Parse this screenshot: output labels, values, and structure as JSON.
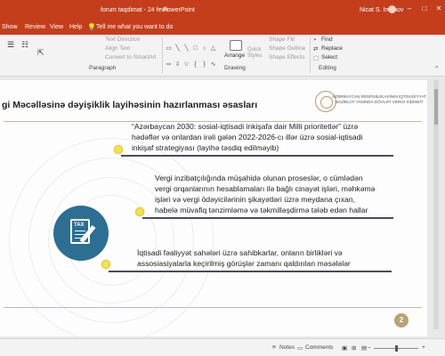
{
  "window": {
    "doc_title": "forum taqdimat - 24 fevli",
    "app_name": "PowerPoint",
    "user_name": "Nicat S. Imanov"
  },
  "tabs": {
    "items": [
      "Show",
      "Review",
      "View",
      "Help"
    ],
    "tell_me": "Tell me what you want to do"
  },
  "ribbon": {
    "paragraph": {
      "text_direction": "Text Direction",
      "align_text": "Align Text",
      "convert_smartart": "Convert to SmartArt",
      "label": "Paragraph"
    },
    "drawing": {
      "arrange": "Arrange",
      "quick_styles": "Quick Styles",
      "shape_fill": "Shape Fill",
      "shape_outline": "Shape Outline",
      "shape_effects": "Shape Effects",
      "label": "Drawing"
    },
    "editing": {
      "find": "Find",
      "replace": "Replace",
      "select": "Select",
      "label": "Editing"
    }
  },
  "slide": {
    "title": "gi Məcəlləsinə dəyişiklik layihəsinin hazırlanması əsasları",
    "logo_text": "AZƏRBAYCAN RESPUBLİKASININ İQTİSADİYYAT NAZİRLİYİ YANINDA DÖVLƏT VERGİ XİDMƏTİ",
    "icon_label": "TAX",
    "points": [
      {
        "lines": [
          "“Azərbaycan 2030: sosial-iqtisadi inkişafa dair Milli prioritetlər” üzrə",
          "hədəflər və onlardan irəli gələn 2022-2026-cı illər üzrə sosial-iqtisadi",
          "inkişaf strategiyası (layihə təsdiq edilməyib)"
        ]
      },
      {
        "lines": [
          "Vergi inzibatçılığında müşahidə olunan proseslər, o cümlədən",
          "vergi orqanlarının hesablamaları ilə bağlı cinayət işləri, məhkəmə",
          "işləri və vergi ödəyicilərinin şikayətləri üzrə meydana çıxan,",
          "habelə müvafiq tənzimləmə və təkmilləşdirmə tələb edən hallar"
        ]
      },
      {
        "lines": [
          "İqtisadi fəaliyyət sahələri üzrə sahibkarlar, onların birlikləri və",
          "assosiasiyalarla keçirilmiş görüşlər zamanı qaldırılan məsələlər"
        ]
      }
    ],
    "page_number": "2"
  },
  "statusbar": {
    "notes": "Notes",
    "comments": "Comments"
  }
}
